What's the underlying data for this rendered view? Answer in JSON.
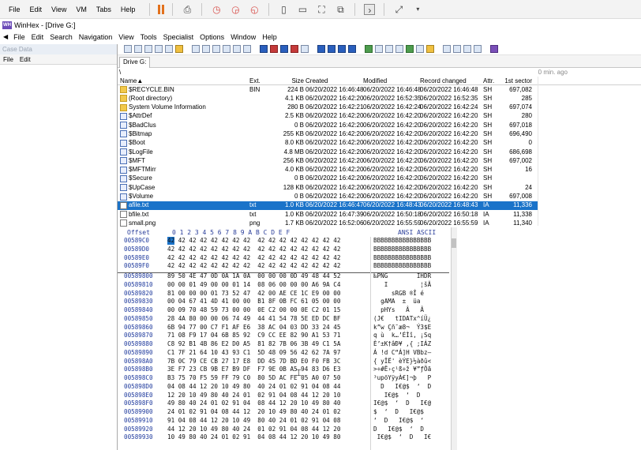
{
  "vm": {
    "menu": [
      "File",
      "Edit",
      "View",
      "VM",
      "Tabs",
      "Help"
    ]
  },
  "app": {
    "title": "WinHex - [Drive G:]",
    "menu": [
      "File",
      "Edit",
      "Search",
      "Navigation",
      "View",
      "Tools",
      "Specialist",
      "Options",
      "Window",
      "Help"
    ]
  },
  "case_panel": {
    "title": "Case Data",
    "menu": [
      "File",
      "Edit"
    ]
  },
  "tab": {
    "label": "Drive G:"
  },
  "path": {
    "root": "\\",
    "ago": "0 min. ago"
  },
  "list": {
    "columns": {
      "name": "Name▲",
      "ext": "Ext.",
      "size": "Size",
      "created": "Created",
      "modified": "Modified",
      "record_changed": "Record changed",
      "attr": "Attr.",
      "sector": "1st sector"
    },
    "rows": [
      {
        "icon": "folder",
        "name": "$RECYCLE.BIN",
        "ext": "BIN",
        "size": "224 B",
        "created": "06/20/2022  16:46:48",
        "modified": "06/20/2022  16:46:48",
        "rc": "06/20/2022  16:46:48",
        "attr": "SH",
        "sector": "697,082"
      },
      {
        "icon": "folder",
        "name": "(Root directory)",
        "ext": "",
        "size": "4.1 KB",
        "created": "06/20/2022  16:42:20",
        "modified": "06/20/2022  16:52:35",
        "rc": "06/20/2022  16:52:35",
        "attr": "SH",
        "sector": "285"
      },
      {
        "icon": "folder",
        "name": "System Volume Information",
        "ext": "",
        "size": "280 B",
        "created": "06/20/2022  16:42:21",
        "modified": "06/20/2022  16:42:24",
        "rc": "06/20/2022  16:42:24",
        "attr": "SH",
        "sector": "697,074"
      },
      {
        "icon": "file",
        "name": "$AttrDef",
        "ext": "",
        "size": "2.5 KB",
        "created": "06/20/2022  16:42:20",
        "modified": "06/20/2022  16:42:20",
        "rc": "06/20/2022  16:42:20",
        "attr": "SH",
        "sector": "280"
      },
      {
        "icon": "file",
        "name": "$BadClus",
        "ext": "",
        "size": "0 B",
        "created": "06/20/2022  16:42:20",
        "modified": "06/20/2022  16:42:20",
        "rc": "06/20/2022  16:42:20",
        "attr": "SH",
        "sector": "697,018"
      },
      {
        "icon": "file",
        "name": "$Bitmap",
        "ext": "",
        "size": "255 KB",
        "created": "06/20/2022  16:42:20",
        "modified": "06/20/2022  16:42:20",
        "rc": "06/20/2022  16:42:20",
        "attr": "SH",
        "sector": "696,490"
      },
      {
        "icon": "file",
        "name": "$Boot",
        "ext": "",
        "size": "8.0 KB",
        "created": "06/20/2022  16:42:20",
        "modified": "06/20/2022  16:42:20",
        "rc": "06/20/2022  16:42:20",
        "attr": "SH",
        "sector": "0"
      },
      {
        "icon": "file",
        "name": "$LogFile",
        "ext": "",
        "size": "4.8 MB",
        "created": "06/20/2022  16:42:20",
        "modified": "06/20/2022  16:42:20",
        "rc": "06/20/2022  16:42:20",
        "attr": "SH",
        "sector": "686,698"
      },
      {
        "icon": "file",
        "name": "$MFT",
        "ext": "",
        "size": "256 KB",
        "created": "06/20/2022  16:42:20",
        "modified": "06/20/2022  16:42:20",
        "rc": "06/20/2022  16:42:20",
        "attr": "SH",
        "sector": "697,002"
      },
      {
        "icon": "file",
        "name": "$MFTMirr",
        "ext": "",
        "size": "4.0 KB",
        "created": "06/20/2022  16:42:20",
        "modified": "06/20/2022  16:42:20",
        "rc": "06/20/2022  16:42:20",
        "attr": "SH",
        "sector": "16"
      },
      {
        "icon": "file",
        "name": "$Secure",
        "ext": "",
        "size": "0 B",
        "created": "06/20/2022  16:42:20",
        "modified": "06/20/2022  16:42:20",
        "rc": "06/20/2022  16:42:20",
        "attr": "SH",
        "sector": ""
      },
      {
        "icon": "file",
        "name": "$UpCase",
        "ext": "",
        "size": "128 KB",
        "created": "06/20/2022  16:42:20",
        "modified": "06/20/2022  16:42:20",
        "rc": "06/20/2022  16:42:20",
        "attr": "SH",
        "sector": "24"
      },
      {
        "icon": "file",
        "name": "$Volume",
        "ext": "",
        "size": "0 B",
        "created": "06/20/2022  16:42:20",
        "modified": "06/20/2022  16:42:20",
        "rc": "06/20/2022  16:42:20",
        "attr": "SH",
        "sector": "697,008"
      },
      {
        "icon": "doc",
        "name": "afile.txt",
        "ext": "txt",
        "size": "1.0 KB",
        "created": "06/20/2022  16:46:47",
        "modified": "06/20/2022  16:48:43",
        "rc": "06/20/2022  16:48:43",
        "attr": "IA",
        "sector": "11,336",
        "selected": true
      },
      {
        "icon": "doc",
        "name": "bfile.txt",
        "ext": "txt",
        "size": "1.0 KB",
        "created": "06/20/2022  16:47:39",
        "modified": "06/20/2022  16:50:18",
        "rc": "06/20/2022  16:50:18",
        "attr": "IA",
        "sector": "11,338"
      },
      {
        "icon": "doc",
        "name": "small.png",
        "ext": "png",
        "size": "1.7 KB",
        "created": "06/20/2022  16:52:06",
        "modified": "06/20/2022  16:55:59",
        "rc": "06/20/2022  16:55:59",
        "attr": "IA",
        "sector": "11,340"
      }
    ]
  },
  "hex": {
    "header_offset": "Offset",
    "header_bytes": "0  1  2  3  4  5  6  7   8  9  A  B  C  D  E  F",
    "header_ascii": "ANSI ASCII",
    "rows": [
      {
        "off": "00589C0",
        "bytes": "42 42 42 42 42 42 42 42  42 42 42 42 42 42 42 42",
        "ascii": "BBBBBBBBBBBBBBBB"
      },
      {
        "off": "00589D0",
        "bytes": "42 42 42 42 42 42 42 42  42 42 42 42 42 42 42 42",
        "ascii": "BBBBBBBBBBBBBBBB"
      },
      {
        "off": "00589E0",
        "bytes": "42 42 42 42 42 42 42 42  42 42 42 42 42 42 42 42",
        "ascii": "BBBBBBBBBBBBBBBB"
      },
      {
        "off": "00589F0",
        "bytes": "42 42 42 42 42 42 42 42  42 42 42 42 42 42 42 42",
        "ascii": "BBBBBBBBBBBBBBBB"
      },
      {
        "off": "00589800",
        "bytes": "89 50 4E 47 0D 0A 1A 0A  00 00 00 0D 49 48 44 52",
        "ascii": "‰PNG        IHDR"
      },
      {
        "off": "00589810",
        "bytes": "00 00 01 49 00 00 01 14  08 06 00 00 00 A6 9A C4",
        "ascii": "   I         ¦šÄ"
      },
      {
        "off": "00589820",
        "bytes": "81 00 00 00 01 73 52 47  42 00 AE CE 1C E9 00 00",
        "ascii": "     sRGB ®Î é  "
      },
      {
        "off": "00589830",
        "bytes": "00 04 67 41 4D 41 00 00  B1 8F 0B FC 61 05 00 00",
        "ascii": "  gAMA  ±  üa   "
      },
      {
        "off": "00589840",
        "bytes": "00 09 70 48 59 73 00 00  0E C2 00 00 0E C2 01 15",
        "ascii": "  pHYs   Â   Â  "
      },
      {
        "off": "00589850",
        "bytes": "28 4A 80 00 00 06 74 49  44 41 54 78 5E ED DC BF",
        "ascii": "(J€   tIDATx^íÜ¿"
      },
      {
        "off": "00589860",
        "bytes": "6B 94 77 00 C7 F1 AF E6  38 AC 04 03 DD 33 24 45",
        "ascii": "k”w Çñ¯æ8¬  Ý3$E"
      },
      {
        "off": "00589870",
        "bytes": "71 08 F9 17 04 6B 85 92  C9 CC EE 82 90 A1 53 71",
        "ascii": "q ù  k…’ÉÌî‚ ¡Sq"
      },
      {
        "off": "00589880",
        "bytes": "C8 92 B1 4B 86 E2 D0 A5  81 82 7B 06 3B 49 C1 5A",
        "ascii": "È’±K†âÐ¥ ‚{ ;IÁZ"
      },
      {
        "off": "00589890",
        "bytes": "C1 7F 21 64 10 43 93 C1  5D 48 09 56 42 62 7A 97",
        "ascii": "Á !d C“Á]H VBbz—"
      },
      {
        "off": "005898A0",
        "bytes": "7B 0C 79 CE CB 27 17 E8  DD 45 7D BD E0 F0 FB 3C",
        "ascii": "{ yÎË' èÝE}½àðû<"
      },
      {
        "off": "005898B0",
        "bytes": "3E F7 23 CB 9B E7 B9 DF  F7 9E 0B A5 94 83 D6 E3",
        "ascii": ">÷#Ë›ç¹ß÷ž ¥”ƒÖã"
      },
      {
        "off": "005898C0",
        "bytes": "B3 75 70 F5 59 FF 79 C0  80 5D AC FE 05 A0 07 50",
        "ascii": "³upõYÿyÀ€]¬þ   P"
      },
      {
        "off": "005898D0",
        "bytes": "04 08 44 12 20 10 49 80  40 24 01 02 91 04 08 44",
        "ascii": "  D   I€@$  ‘  D"
      },
      {
        "off": "005898E0",
        "bytes": "12 20 10 49 80 40 24 01  02 91 04 08 44 12 20 10",
        "ascii": "   I€@$  ‘  D   "
      },
      {
        "off": "005898F0",
        "bytes": "49 80 40 24 01 02 91 04  08 44 12 20 10 49 80 40",
        "ascii": "I€@$  ‘  D   I€@"
      },
      {
        "off": "00589900",
        "bytes": "24 01 02 91 04 08 44 12  20 10 49 80 40 24 01 02",
        "ascii": "$  ‘  D   I€@$  "
      },
      {
        "off": "00589910",
        "bytes": "91 04 08 44 12 20 10 49  80 40 24 01 02 91 04 08",
        "ascii": "‘  D   I€@$  ‘  "
      },
      {
        "off": "00589920",
        "bytes": "44 12 20 10 49 80 40 24  01 02 91 04 08 44 12 20",
        "ascii": "D   I€@$  ‘  D  "
      },
      {
        "off": "00589930",
        "bytes": "10 49 80 40 24 01 02 91  04 08 44 12 20 10 49 80",
        "ascii": " I€@$  ‘  D   I€"
      }
    ]
  }
}
